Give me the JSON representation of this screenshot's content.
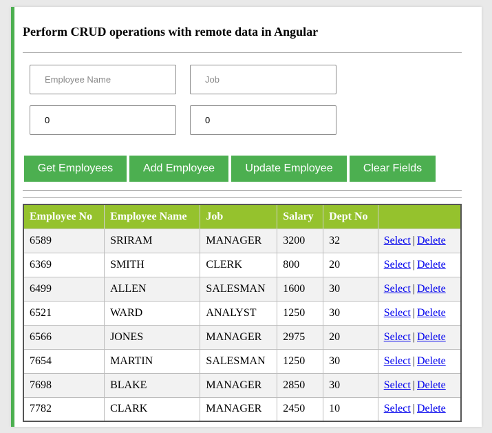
{
  "header": {
    "title": "Perform CRUD operations with remote data in Angular"
  },
  "form": {
    "name": {
      "value": "",
      "placeholder": "Employee Name"
    },
    "job": {
      "value": "",
      "placeholder": "Job"
    },
    "salary": {
      "value": "0",
      "placeholder": ""
    },
    "dept": {
      "value": "0",
      "placeholder": ""
    }
  },
  "buttons": {
    "get": "Get Employees",
    "add": "Add Employee",
    "update": "Update Employee",
    "clear": "Clear Fields"
  },
  "table": {
    "columns": [
      "Employee No",
      "Employee Name",
      "Job",
      "Salary",
      "Dept No",
      ""
    ],
    "select_label": "Select",
    "delete_label": "Delete",
    "separator": "|",
    "rows": [
      {
        "empno": "6589",
        "name": "SRIRAM",
        "job": "MANAGER",
        "salary": "3200",
        "dept": "32"
      },
      {
        "empno": "6369",
        "name": "SMITH",
        "job": "CLERK",
        "salary": "800",
        "dept": "20"
      },
      {
        "empno": "6499",
        "name": "ALLEN",
        "job": "SALESMAN",
        "salary": "1600",
        "dept": "30"
      },
      {
        "empno": "6521",
        "name": "WARD",
        "job": "ANALYST",
        "salary": "1250",
        "dept": "30"
      },
      {
        "empno": "6566",
        "name": "JONES",
        "job": "MANAGER",
        "salary": "2975",
        "dept": "20"
      },
      {
        "empno": "7654",
        "name": "MARTIN",
        "job": "SALESMAN",
        "salary": "1250",
        "dept": "30"
      },
      {
        "empno": "7698",
        "name": "BLAKE",
        "job": "MANAGER",
        "salary": "2850",
        "dept": "30"
      },
      {
        "empno": "7782",
        "name": "CLARK",
        "job": "MANAGER",
        "salary": "2450",
        "dept": "10"
      }
    ]
  },
  "colors": {
    "accent_border": "#4caf50",
    "button_bg": "#4caf50",
    "table_header_bg": "#95c22d",
    "link": "#0000ee"
  }
}
